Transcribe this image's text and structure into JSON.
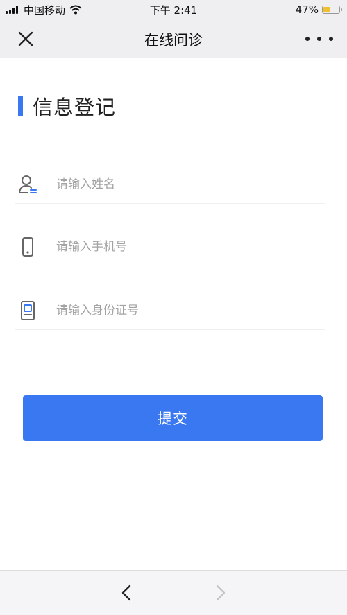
{
  "status_bar": {
    "carrier": "中国移动",
    "time": "下午 2:41",
    "battery_percent_label": "47%",
    "battery_level": 0.47,
    "icons": [
      "signal-icon",
      "wifi-icon",
      "battery-icon"
    ]
  },
  "nav": {
    "title": "在线问诊",
    "close_icon": "close-icon",
    "more_icon": "more-icon"
  },
  "form": {
    "section_title": "信息登记",
    "accent_color": "#3a78f2",
    "fields": [
      {
        "icon": "user-icon",
        "placeholder": "请输入姓名",
        "value": ""
      },
      {
        "icon": "phone-icon",
        "placeholder": "请输入手机号",
        "value": ""
      },
      {
        "icon": "id-card-icon",
        "placeholder": "请输入身份证号",
        "value": ""
      }
    ],
    "submit_label": "提交"
  },
  "bottom_bar": {
    "back_icon": "chevron-left-icon",
    "forward_icon": "chevron-right-icon",
    "forward_enabled": false
  }
}
